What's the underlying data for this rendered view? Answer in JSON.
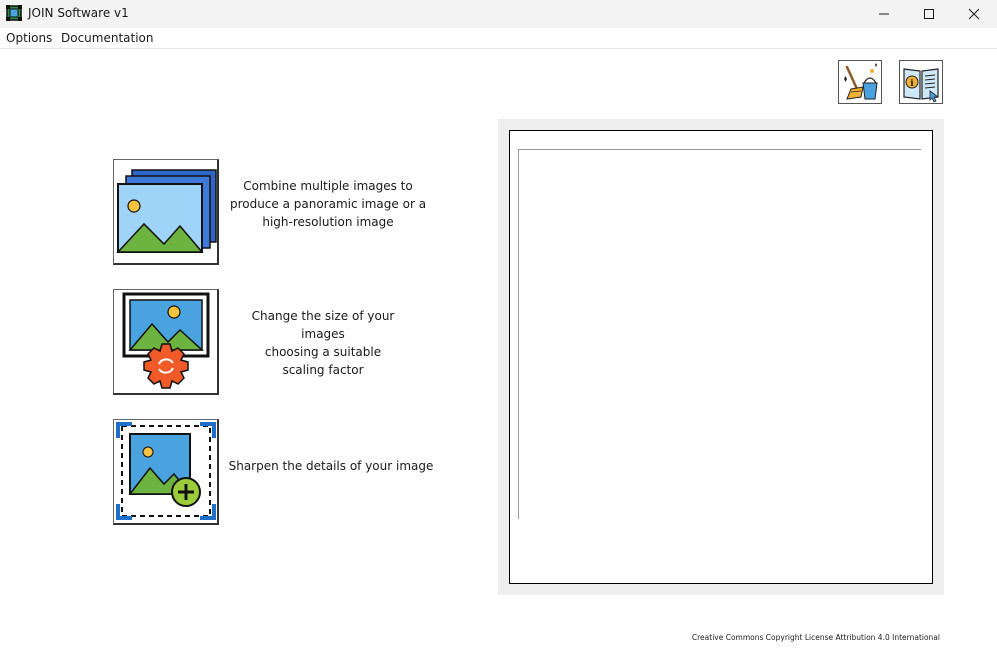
{
  "window": {
    "title": "JOIN Software v1",
    "controls": [
      "minimize",
      "maximize",
      "close"
    ]
  },
  "menu": {
    "items": [
      {
        "label": "Options"
      },
      {
        "label": "Documentation"
      }
    ]
  },
  "toolbar": {
    "buttons": [
      {
        "icon": "broom-bucket-icon"
      },
      {
        "icon": "info-manual-icon"
      }
    ]
  },
  "features": [
    {
      "icon": "stacked-images-icon",
      "text": "Combine multiple images to\nproduce a panoramic image or a\nhigh-resolution image"
    },
    {
      "icon": "image-resize-gear-icon",
      "text": "Change the size of your images\nchoosing a suitable\nscaling factor"
    },
    {
      "icon": "image-sharpen-plus-icon",
      "text": "Sharpen the details of your image"
    }
  ],
  "footer": {
    "license": "Creative Commons Copyright License Attribution 4.0 International"
  }
}
